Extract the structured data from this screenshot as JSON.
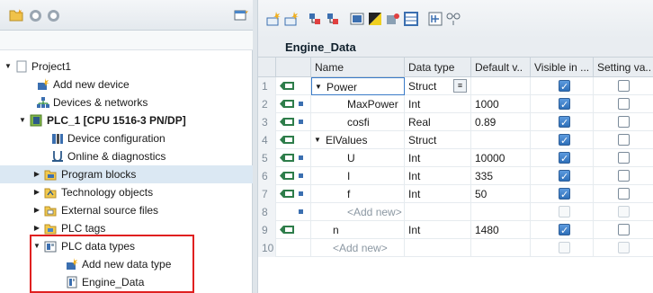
{
  "tree": {
    "project": "Project1",
    "add_device": "Add new device",
    "devices_networks": "Devices & networks",
    "plc": "PLC_1 [CPU 1516-3 PN/DP]",
    "device_config": "Device configuration",
    "online_diag": "Online & diagnostics",
    "program_blocks": "Program blocks",
    "technology_objects": "Technology objects",
    "external_sources": "External source files",
    "plc_tags": "PLC tags",
    "plc_data_types": "PLC data types",
    "add_data_type": "Add new data type",
    "engine_data": "Engine_Data"
  },
  "editor": {
    "title": "Engine_Data",
    "columns": [
      "Name",
      "Data type",
      "Default v..",
      "Visible in ...",
      "Setting va.."
    ],
    "rows": [
      {
        "num": "1",
        "name": "Power",
        "type": "Struct",
        "default": "",
        "visible": true,
        "setting": false
      },
      {
        "num": "2",
        "name": "MaxPower",
        "type": "Int",
        "default": "1000",
        "visible": true,
        "setting": false
      },
      {
        "num": "3",
        "name": "cosfi",
        "type": "Real",
        "default": "0.89",
        "visible": true,
        "setting": false
      },
      {
        "num": "4",
        "name": "ElValues",
        "type": "Struct",
        "default": "",
        "visible": true,
        "setting": false
      },
      {
        "num": "5",
        "name": "U",
        "type": "Int",
        "default": "10000",
        "visible": true,
        "setting": false
      },
      {
        "num": "6",
        "name": "I",
        "type": "Int",
        "default": "335",
        "visible": true,
        "setting": false
      },
      {
        "num": "7",
        "name": "f",
        "type": "Int",
        "default": "50",
        "visible": true,
        "setting": false
      },
      {
        "num": "8",
        "name": "<Add new>",
        "type": "",
        "default": "",
        "visible": false,
        "setting": false
      },
      {
        "num": "9",
        "name": "n",
        "type": "Int",
        "default": "1480",
        "visible": true,
        "setting": false
      },
      {
        "num": "10",
        "name": "<Add new>",
        "type": "",
        "default": "",
        "visible": false,
        "setting": false
      }
    ]
  },
  "colors": {
    "accent": "#2e6fb8",
    "selection": "#cfe3f3",
    "annotation": "#e02020"
  }
}
